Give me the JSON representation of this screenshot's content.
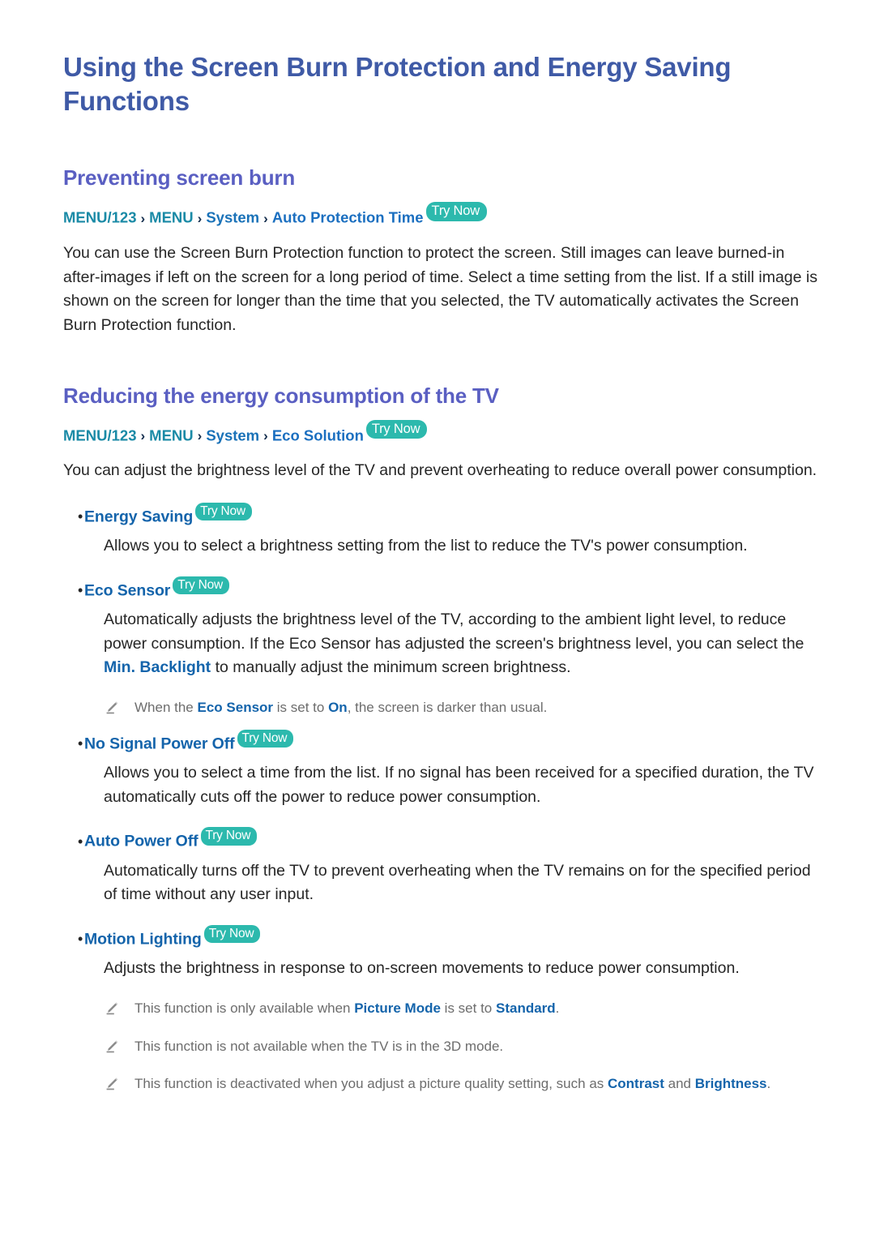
{
  "document": {
    "title": "Using the Screen Burn Protection and Energy Saving Functions"
  },
  "colors": {
    "title": "#3f5aa6",
    "section_heading": "#5a5fc2",
    "breadcrumb_teal": "#1a8aa6",
    "breadcrumb_blue": "#1b6fc0",
    "bullet_label": "#1464ab",
    "badge_bg": "#2cb9ad",
    "body_text": "#262626",
    "note_text": "#6d6d6d"
  },
  "badges": {
    "try_now": "Try Now"
  },
  "sections": [
    {
      "heading": "Preventing screen burn",
      "breadcrumb": {
        "items": [
          "MENU/123",
          "MENU",
          "System",
          "Auto Protection Time"
        ],
        "separator": "›"
      },
      "paragraph": "You can use the Screen Burn Protection function to protect the screen. Still images can leave burned-in after-images if left on the screen for a long period of time. Select a time setting from the list. If a still image is shown on the screen for longer than the time that you selected, the TV automatically activates the Screen Burn Protection function."
    },
    {
      "heading": "Reducing the energy consumption of the TV",
      "breadcrumb": {
        "items": [
          "MENU/123",
          "MENU",
          "System",
          "Eco Solution"
        ],
        "separator": "›"
      },
      "paragraph": "You can adjust the brightness level of the TV and prevent overheating to reduce overall power consumption."
    }
  ],
  "bullets": [
    {
      "label": "Energy Saving",
      "badge": "Try Now",
      "description": "Allows you to select a brightness setting from the list to reduce the TV's power consumption.",
      "notes": []
    },
    {
      "label": "Eco Sensor",
      "badge": "Try Now",
      "description_parts": {
        "before": "Automatically adjusts the brightness level of the TV, according to the ambient light level, to reduce power consumption. If the Eco Sensor has adjusted the screen's brightness level, you can select the ",
        "highlight": "Min. Backlight",
        "after": " to manually adjust the minimum screen brightness."
      },
      "notes": [
        {
          "before": "When the ",
          "hl1": "Eco Sensor",
          "middle": " is set to ",
          "hl2": "On",
          "after": ", the screen is darker than usual."
        }
      ]
    },
    {
      "label": "No Signal Power Off",
      "badge": "Try Now",
      "description": "Allows you to select a time from the list. If no signal has been received for a specified duration, the TV automatically cuts off the power to reduce power consumption.",
      "notes": []
    },
    {
      "label": "Auto Power Off",
      "badge": "Try Now",
      "description": "Automatically turns off the TV to prevent overheating when the TV remains on for the specified period of time without any user input.",
      "notes": []
    },
    {
      "label": "Motion Lighting",
      "badge": "Try Now",
      "description": "Adjusts the brightness in response to on-screen movements to reduce power consumption.",
      "notes": []
    }
  ],
  "footer_notes": [
    {
      "before": "This function is only available when ",
      "hl1": "Picture Mode",
      "middle": " is set to ",
      "hl2": "Standard",
      "after": "."
    },
    {
      "before": "This function is not available when the TV is in the 3D mode.",
      "hl1": "",
      "middle": "",
      "hl2": "",
      "after": ""
    },
    {
      "before": "This function is deactivated when you adjust a picture quality setting, such as ",
      "hl1": "Contrast",
      "middle": " and ",
      "hl2": "Brightness",
      "after": "."
    }
  ]
}
